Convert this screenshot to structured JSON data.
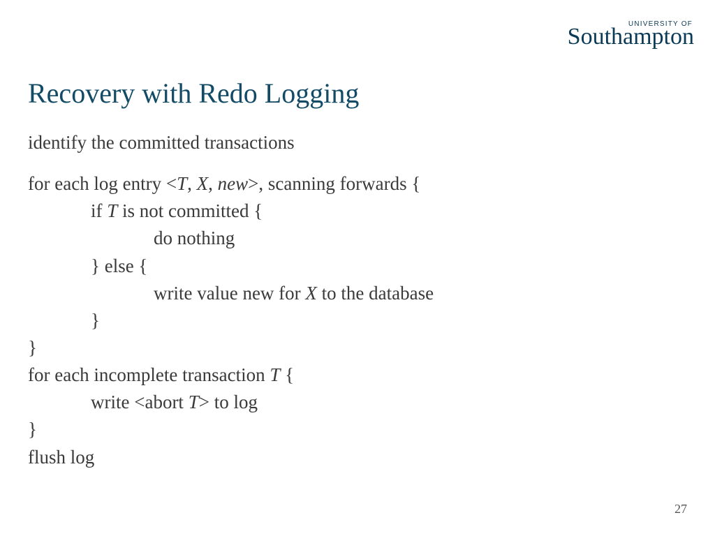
{
  "logo": {
    "small": "UNIVERSITY OF",
    "big": "Southampton"
  },
  "title": "Recovery with Redo Logging",
  "p1": "identify the committed transactions",
  "l1a": "for each log entry <",
  "l1_T": "T",
  "l1_c1": ", ",
  "l1_X": "X",
  "l1_c2": ", ",
  "l1_new": "new",
  "l1b": ">, scanning forwards {",
  "l2a": "if  ",
  "l2_T": "T",
  "l2b": " is not committed {",
  "l3": "do nothing",
  "l4": "} else {",
  "l5a": "write value new for ",
  "l5_X": "X",
  "l5b": " to the database",
  "l6": "}",
  "l7": "}",
  "l8a": "for each incomplete transaction ",
  "l8_T": "T",
  "l8b": " {",
  "l9a": "write <abort ",
  "l9_T": "T",
  "l9b": "> to log",
  "l10": "}",
  "l11": "flush log",
  "pagenum": "27"
}
